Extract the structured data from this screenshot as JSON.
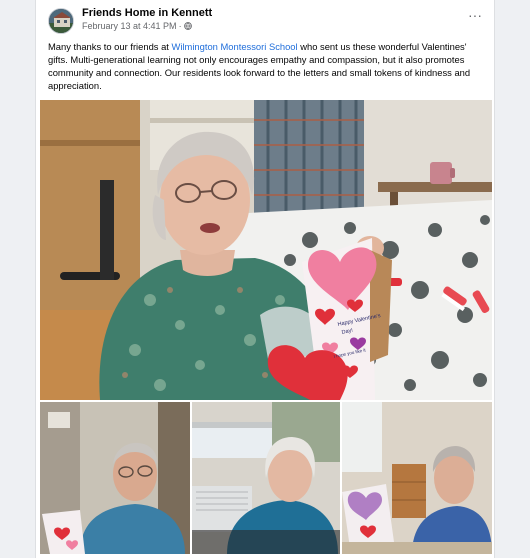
{
  "post": {
    "page_name": "Friends Home in Kennett",
    "date": "February 13 at 4:41 PM",
    "separator": "·",
    "more_label": "···",
    "text_before_link": "Many thanks to our friends at ",
    "link_text": "Wilmington Montessori School",
    "text_after_link": "  who sent us these wonderful Valentines' gifts.  Multi-generational learning not only encourages empathy and compassion, but it also promotes community and connection.  Our residents look forward to the letters and small tokens of kindness and appreciation."
  },
  "card_text": {
    "line1": "Happy Valentine's",
    "line2": "Day!",
    "line3": "I hope you like it"
  },
  "colors": {
    "link": "#216fdb",
    "heart_red": "#e0303a",
    "heart_pink": "#f07fa0"
  },
  "icons": [
    "globe-icon",
    "more-options-icon"
  ]
}
